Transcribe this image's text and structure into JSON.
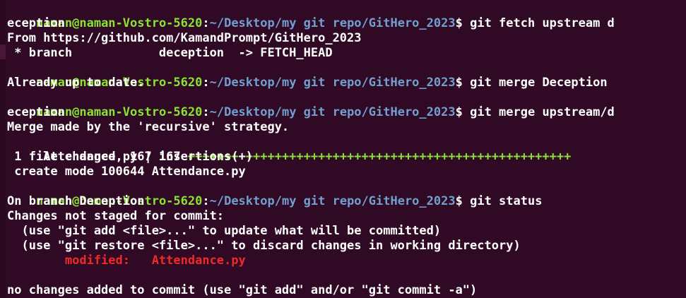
{
  "terminal": {
    "prompt": {
      "user": "naman@naman-Vostro-5620",
      "sep": ":",
      "path": "~/Desktop/my git repo/GitHero_2023",
      "dollar": "$"
    },
    "lines": [
      {
        "kind": "prompt",
        "cmd": " git fetch upstream d"
      },
      {
        "kind": "out",
        "text": "eception"
      },
      {
        "kind": "out",
        "text": "From https://github.com/KamandPrompt/GitHero_2023"
      },
      {
        "kind": "out",
        "text": " * branch            deception  -> FETCH_HEAD"
      },
      {
        "kind": "prompt",
        "cmd": " git merge Deception"
      },
      {
        "kind": "out",
        "text": "Already up to date."
      },
      {
        "kind": "prompt",
        "cmd": " git merge upstream/d"
      },
      {
        "kind": "out",
        "text": "eception"
      },
      {
        "kind": "out",
        "text": "Merge made by the 'recursive' strategy."
      },
      {
        "kind": "diffstat",
        "text": " Attendance.py | 167 ",
        "plus": "+++++++++++++++++++++++++++++++++++++++++++++++++++++"
      },
      {
        "kind": "out",
        "text": " 1 file changed, 167 insertions(+)"
      },
      {
        "kind": "out",
        "text": " create mode 100644 Attendance.py"
      },
      {
        "kind": "prompt",
        "cmd": " git status"
      },
      {
        "kind": "out",
        "text": "On branch Deception"
      },
      {
        "kind": "out",
        "text": "Changes not staged for commit:"
      },
      {
        "kind": "out",
        "text": "  (use \"git add <file>...\" to update what will be committed)"
      },
      {
        "kind": "out",
        "text": "  (use \"git restore <file>...\" to discard changes in working directory)"
      },
      {
        "kind": "red",
        "text": "        modified:   Attendance.py"
      },
      {
        "kind": "out",
        "text": ""
      },
      {
        "kind": "out",
        "text": "no changes added to commit (use \"git add\" and/or \"git commit -a\")"
      }
    ]
  },
  "colors": {
    "background": "#300a24",
    "prompt_user": "#8ae234",
    "prompt_path": "#729fcf",
    "text": "#ffffff",
    "diff_plus": "#8ae234",
    "modified": "#ef2929"
  }
}
